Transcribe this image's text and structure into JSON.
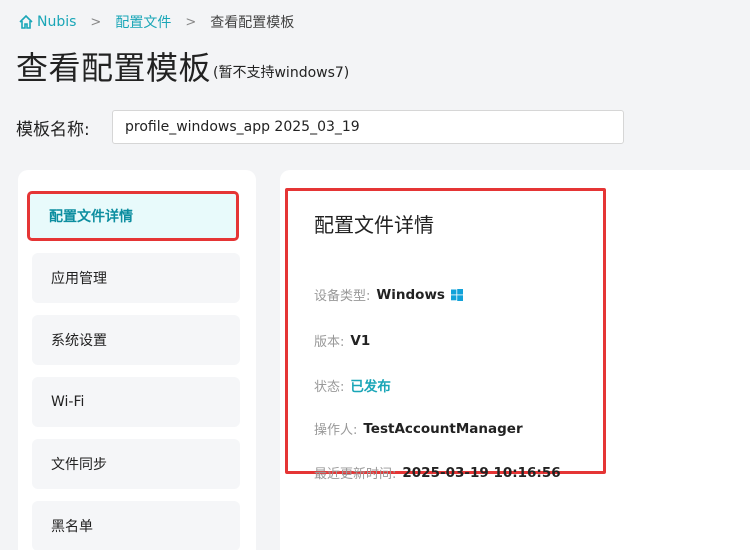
{
  "breadcrumb": {
    "home": "Nubis",
    "level1": "配置文件",
    "current": "查看配置模板",
    "separator": ">"
  },
  "page": {
    "title": "查看配置模板",
    "note": "(暂不支持windows7)"
  },
  "template": {
    "label": "模板名称:",
    "value": "profile_windows_app 2025_03_19"
  },
  "sidebar": {
    "items": [
      {
        "label": "配置文件详情"
      },
      {
        "label": "应用管理"
      },
      {
        "label": "系统设置"
      },
      {
        "label": "Wi-Fi"
      },
      {
        "label": "文件同步"
      },
      {
        "label": "黑名单"
      }
    ]
  },
  "details": {
    "title": "配置文件详情",
    "device_type_label": "设备类型:",
    "device_type_value": "Windows",
    "version_label": "版本:",
    "version_value": "V1",
    "status_label": "状态:",
    "status_value": "已发布",
    "operator_label": "操作人:",
    "operator_value": "TestAccountManager",
    "updated_label": "最近更新时间:",
    "updated_value": "2025-03-19 10:16:56"
  },
  "colors": {
    "accent": "#1aa6b7",
    "highlight_border": "#e53535",
    "windows_icon": "#12a2d9"
  }
}
